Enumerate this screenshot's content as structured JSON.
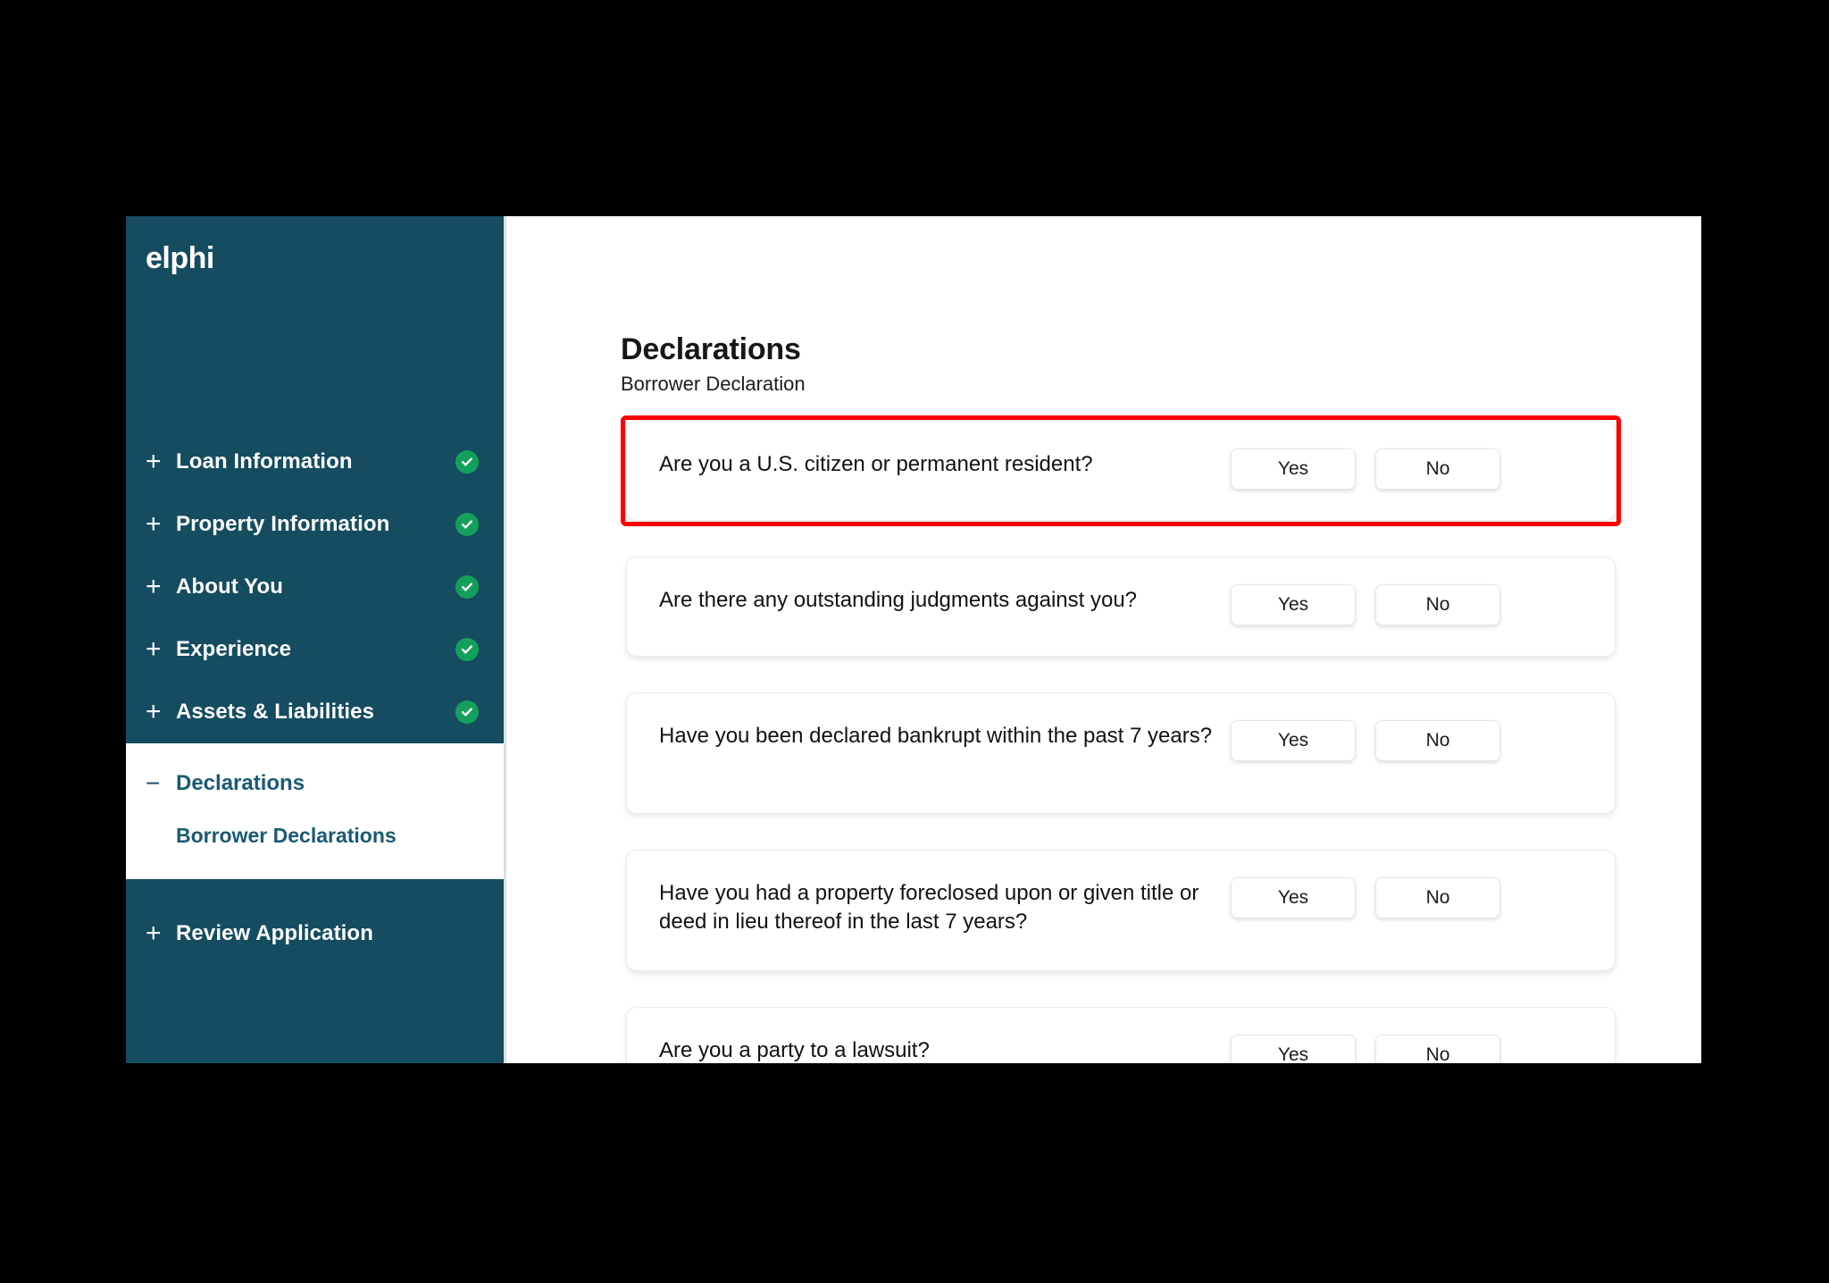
{
  "brand": {
    "name": "elphi"
  },
  "colors": {
    "sidebar_bg": "#154C60",
    "accent_teal": "#1A5A73",
    "check_green": "#13A05C",
    "highlight_red": "#FF0000"
  },
  "sidebar": {
    "primary_items": [
      {
        "label": "Loan Information",
        "icon": "plus-icon",
        "status": "complete",
        "status_icon": "check-circle-icon"
      },
      {
        "label": "Property Information",
        "icon": "plus-icon",
        "status": "complete",
        "status_icon": "check-circle-icon"
      },
      {
        "label": "About You",
        "icon": "plus-icon",
        "status": "complete",
        "status_icon": "check-circle-icon"
      },
      {
        "label": "Experience",
        "icon": "plus-icon",
        "status": "complete",
        "status_icon": "check-circle-icon"
      },
      {
        "label": "Assets & Liabilities",
        "icon": "plus-icon",
        "status": "complete",
        "status_icon": "check-circle-icon"
      }
    ],
    "declarations": {
      "label": "Declarations",
      "icon": "minus-icon",
      "expanded": true,
      "children": [
        {
          "label": "Borrower Declarations",
          "active": true
        }
      ]
    },
    "review": {
      "label": "Review Application",
      "icon": "plus-icon"
    }
  },
  "main": {
    "title": "Declarations",
    "subtitle": "Borrower Declaration",
    "answer_labels": {
      "yes": "Yes",
      "no": "No"
    },
    "questions": [
      {
        "text": "Are you a U.S. citizen or permanent resident?",
        "highlighted": true,
        "tall": false
      },
      {
        "text": "Are there any outstanding judgments against you?",
        "highlighted": false,
        "tall": false
      },
      {
        "text": "Have you been declared bankrupt within the past 7 years?",
        "highlighted": false,
        "tall": true
      },
      {
        "text": "Have you had a property foreclosed upon or given title or deed in lieu thereof in the last 7 years?",
        "highlighted": false,
        "tall": true
      },
      {
        "text": "Are you a party to a lawsuit?",
        "highlighted": false,
        "tall": false
      }
    ]
  }
}
